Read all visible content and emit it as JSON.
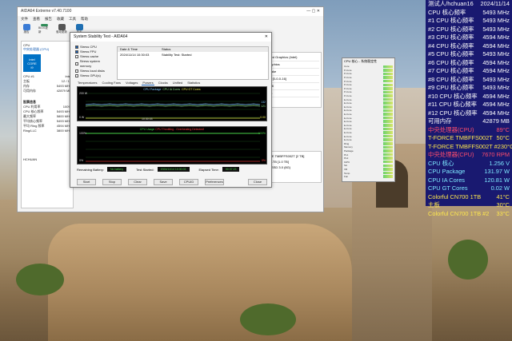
{
  "main_window": {
    "title": "AIDA64 Extreme v7.40.7100",
    "title_buttons": "—  ▢  ✕",
    "menu": [
      "文件",
      "查看",
      "报告",
      "收藏",
      "工具",
      "帮助"
    ],
    "toolbar": [
      {
        "label": "报告",
        "icon": "report-icon",
        "color": "#3a7bd5"
      },
      {
        "label": "BIOS更新",
        "icon": "bios-icon",
        "color": "#2e8b57"
      },
      {
        "label": "驱动更新",
        "icon": "driver-icon",
        "color": "#555555"
      },
      {
        "label": "关于",
        "icon": "info-icon",
        "color": "#1f6fb2"
      }
    ],
    "left_panel": {
      "header": "CPU",
      "subheader": "中央处理器 (CPU)",
      "brand_line1": "intel",
      "brand_line2": "CORE",
      "brand_line3": "i9",
      "fields": [
        [
          "CPU #1",
          "Intel"
        ],
        [
          "主板",
          "12 / 12"
        ],
        [
          "内存",
          "5493 MHz"
        ],
        [
          "可用内存",
          "42879 MB"
        ]
      ],
      "section_title": "股票信息",
      "stats": [
        [
          "CPU 利用率",
          "100%"
        ],
        [
          "CPU 核心频率",
          "5493 MHz"
        ],
        [
          "最大频率",
          "5800 MHz"
        ],
        [
          "平均核心频率",
          "5493 MHz"
        ],
        [
          "平均 Ring 频率",
          "4594 MHz"
        ],
        [
          "Ring/LLC",
          "3800 MHz"
        ]
      ],
      "footer": "HCHUAN"
    },
    "right_panel": [
      "Integrated Graphics (Intel)",
      "Intel Graphics",
      "Arrow Lake",
      "[0.0.0.2] [0-0-0-16]",
      "Boost: 68",
      "Revision"
    ],
    "right_panel2": [
      "T-FORCE TMBFFS002T [2 TB]",
      "CN700 1TB [1.0 TB]",
      "mSATA SSD 3.0 (8G)"
    ]
  },
  "stability": {
    "title": "System Stability Test - AIDA64",
    "options": [
      {
        "label": "Stress CPU",
        "checked": true
      },
      {
        "label": "Stress FPU",
        "checked": true
      },
      {
        "label": "Stress cache",
        "checked": false
      },
      {
        "label": "Stress system memory",
        "checked": false
      },
      {
        "label": "Stress local disks",
        "checked": false
      },
      {
        "label": "Stress GPU(s)",
        "checked": false
      }
    ],
    "table": {
      "headers": [
        "Date & Time",
        "Status"
      ],
      "rows": [
        [
          "2024/11/14 10:30:03",
          "Stability Test: Started"
        ]
      ]
    },
    "tabs": [
      "Temperatures",
      "Cooling Fans",
      "Voltages",
      "Powers",
      "Clocks",
      "Unified",
      "Statistics"
    ],
    "active_tab": "Powers",
    "graph1": {
      "legend": [
        "CPU Package",
        "CPU IA Cores",
        "CPU GT Cores"
      ],
      "ymax_label": "200 W",
      "ymin_label": "0 W",
      "right_labels": [
        "132",
        "121"
      ],
      "bottom_right": "0.00",
      "time_label": "10:30:03"
    },
    "graph2": {
      "legend_prefix": "CPU Usage",
      "legend_suffix": "CPU Throttling - Overheating Detected!",
      "ymax_label": "100%",
      "ymin_label": "0%",
      "right_max": "100%",
      "right_min": "0%"
    },
    "status_row": {
      "battery_label": "Remaining Battery:",
      "battery_value": "No battery",
      "started_label": "Test Started:",
      "started_value": "2024/11/14 10:30:03",
      "elapsed_label": "Elapsed Time:",
      "elapsed_value": "00:37:23"
    },
    "buttons": [
      "Start",
      "Stop",
      "Clear",
      "Save",
      "CPUID",
      "Preferences",
      "Close"
    ]
  },
  "sensor_window": {
    "title": "CPU 核心 - 系统稳定性",
    "rows": [
      "Core",
      "P-Core",
      "P-Core",
      "P-Core",
      "P-Core",
      "P-Core",
      "P-Core",
      "P-Core",
      "P-Core",
      "E-Core",
      "E-Core",
      "E-Core",
      "E-Core",
      "E-Core",
      "E-Core",
      "E-Core",
      "E-Core",
      "E-Core",
      "E-Core",
      "E-Core",
      "E-Core",
      "Ring",
      "Memory",
      "Package",
      "PL1",
      "PL2",
      "iGPU",
      "SA",
      "VR",
      "Temp",
      "Fan"
    ]
  },
  "osd": {
    "rows": [
      {
        "label": "测试人/hchuan16",
        "value": "2024/11/14",
        "color": "#ffffff"
      },
      {
        "label": "CPU 核心频率",
        "value": "5493 MHz",
        "color": "#ffffff"
      },
      {
        "label": "#1 CPU 核心频率",
        "value": "5493 MHz",
        "color": "#ffffff"
      },
      {
        "label": "#2 CPU 核心频率",
        "value": "5493 MHz",
        "color": "#ffffff"
      },
      {
        "label": "#3 CPU 核心频率",
        "value": "4594 MHz",
        "color": "#ffffff"
      },
      {
        "label": "#4 CPU 核心频率",
        "value": "4594 MHz",
        "color": "#ffffff"
      },
      {
        "label": "#5 CPU 核心频率",
        "value": "5493 MHz",
        "color": "#ffffff"
      },
      {
        "label": "#6 CPU 核心频率",
        "value": "4594 MHz",
        "color": "#ffffff"
      },
      {
        "label": "#7 CPU 核心频率",
        "value": "4594 MHz",
        "color": "#ffffff"
      },
      {
        "label": "#8 CPU 核心频率",
        "value": "5493 MHz",
        "color": "#ffffff"
      },
      {
        "label": "#9 CPU 核心频率",
        "value": "5493 MHz",
        "color": "#ffffff"
      },
      {
        "label": "#10 CPU 核心频率",
        "value": "4594 MHz",
        "color": "#ffffff"
      },
      {
        "label": "#11 CPU 核心频率",
        "value": "4594 MHz",
        "color": "#ffffff"
      },
      {
        "label": "#12 CPU 核心频率",
        "value": "4594 MHz",
        "color": "#ffffff"
      },
      {
        "label": "可用内存",
        "value": "42879 MB",
        "color": "#ffffff"
      },
      {
        "label": "中央处理器(CPU)",
        "value": "89°C",
        "color": "#ff4d6d"
      },
      {
        "label": "T-FORCE TMBFFS002T",
        "value": "50°C",
        "color": "#ffe84d"
      },
      {
        "label": "T-FORCE TMBFFS002T #2",
        "value": "30°C",
        "color": "#ffe84d"
      },
      {
        "label": "中央处理器(CPU)",
        "value": "7670 RPM",
        "color": "#ff4d6d"
      },
      {
        "label": "CPU 核心",
        "value": "1.256 V",
        "color": "#7ee8ff"
      },
      {
        "label": "CPU Package",
        "value": "131.97 W",
        "color": "#7ee8ff"
      },
      {
        "label": "CPU IA Cores",
        "value": "120.81 W",
        "color": "#7ee8ff"
      },
      {
        "label": "CPU GT Cores",
        "value": "0.02 W",
        "color": "#7ee8ff"
      },
      {
        "label": "Colorful CN700 1TB",
        "value": "41°C",
        "color": "#ffe84d"
      },
      {
        "label": "主板",
        "value": "30°C",
        "color": "#ffe84d"
      },
      {
        "label": "Colorful CN700 1TB #2",
        "value": "33°C",
        "color": "#ffe84d"
      }
    ]
  }
}
